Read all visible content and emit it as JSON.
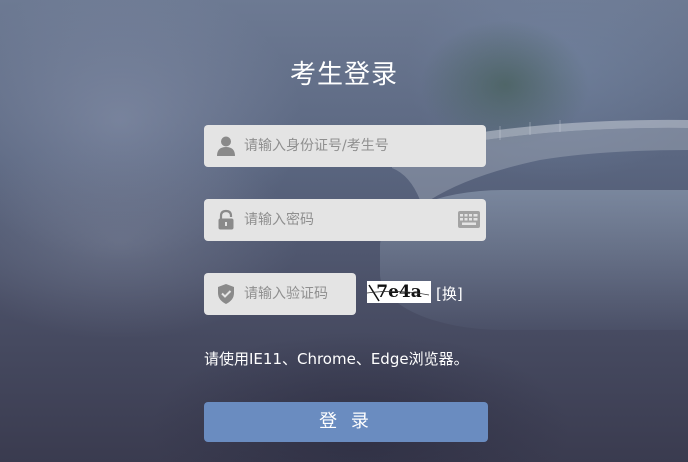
{
  "title": "考生登录",
  "id_field": {
    "placeholder": "请输入身份证号/考生号",
    "value": "",
    "icon": "user-icon"
  },
  "password_field": {
    "placeholder": "请输入密码",
    "value": "",
    "icon": "lock-icon",
    "keyboard_icon": "keyboard-icon"
  },
  "captcha_field": {
    "placeholder": "请输入验证码",
    "value": "",
    "icon": "shield-icon",
    "captcha_text": "7e4a",
    "refresh_label": "[换]"
  },
  "browser_note": "请使用IE11、Chrome、Edge浏览器。",
  "login_button": {
    "label": "登 录",
    "color": "#6a8cc0"
  }
}
